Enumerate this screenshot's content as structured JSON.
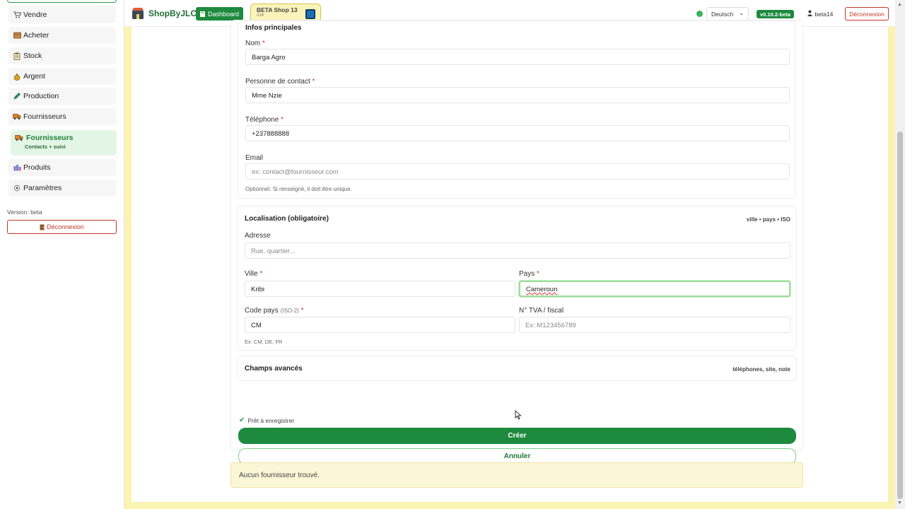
{
  "sidebar": {
    "items": [
      {
        "label": "Vendre",
        "icon": "cart-icon"
      },
      {
        "label": "Acheter",
        "icon": "box-icon"
      },
      {
        "label": "Stock",
        "icon": "clipboard-icon"
      },
      {
        "label": "Argent",
        "icon": "money-bag-icon"
      },
      {
        "label": "Production",
        "icon": "pencil-icon"
      },
      {
        "label": "Fournisseurs",
        "icon": "truck-icon"
      }
    ],
    "active": {
      "label": "Fournisseurs",
      "sub": "Contacts + suivi",
      "icon": "truck-icon"
    },
    "items_after": [
      {
        "label": "Produits",
        "icon": "products-icon"
      },
      {
        "label": "Paramètres",
        "icon": "gear-icon"
      }
    ],
    "version": "Version: beta",
    "logout": "Déconnexion"
  },
  "topbar": {
    "brand": "ShopByJLC",
    "dashboard": "Dashboard",
    "shop_name": "BETA Shop 13",
    "shop_number": "#14",
    "language": "Deutsch",
    "version_badge": "v0.10.2-beta",
    "user": "beta14",
    "logout": "Déconnexion"
  },
  "form": {
    "section_main_title": "Infos principales",
    "name_label": "Nom",
    "name_value": "Barga Agro",
    "contact_label": "Personne de contact",
    "contact_value": "Mme Nzie",
    "phone_label": "Téléphone",
    "phone_value": "+237888888",
    "email_label": "Email",
    "email_placeholder": "ex: contact@fournisseur.com",
    "email_hint": "Optionnel. Si renseigné, il doit être unique.",
    "location_title": "Localisation (obligatoire)",
    "location_note": "ville • pays • ISO",
    "address_label": "Adresse",
    "address_placeholder": "Rue, quartier...",
    "city_label": "Ville",
    "city_value": "Kribi",
    "country_label": "Pays",
    "country_value": "Cameroun",
    "code_label": "Code pays",
    "code_sub": "(ISO-2)",
    "code_value": "CM",
    "code_hint": "Ex: CM, DE, FR",
    "tax_label": "N° TVA / fiscal",
    "tax_placeholder": "Ex: M123456789",
    "advanced_title": "Champs avancés",
    "advanced_note": "téléphones, site, note",
    "ready_text": "Prêt à enregistrer",
    "create_label": "Créer",
    "cancel_label": "Annuler",
    "required_mark": "*"
  },
  "empty_message": "Aucun fournisseur trouvé.",
  "colors": {
    "primary": "#1e8a3e",
    "danger": "#c0392b",
    "page_bg": "#fbf3b0",
    "active_nav": "#e3f6e6"
  }
}
